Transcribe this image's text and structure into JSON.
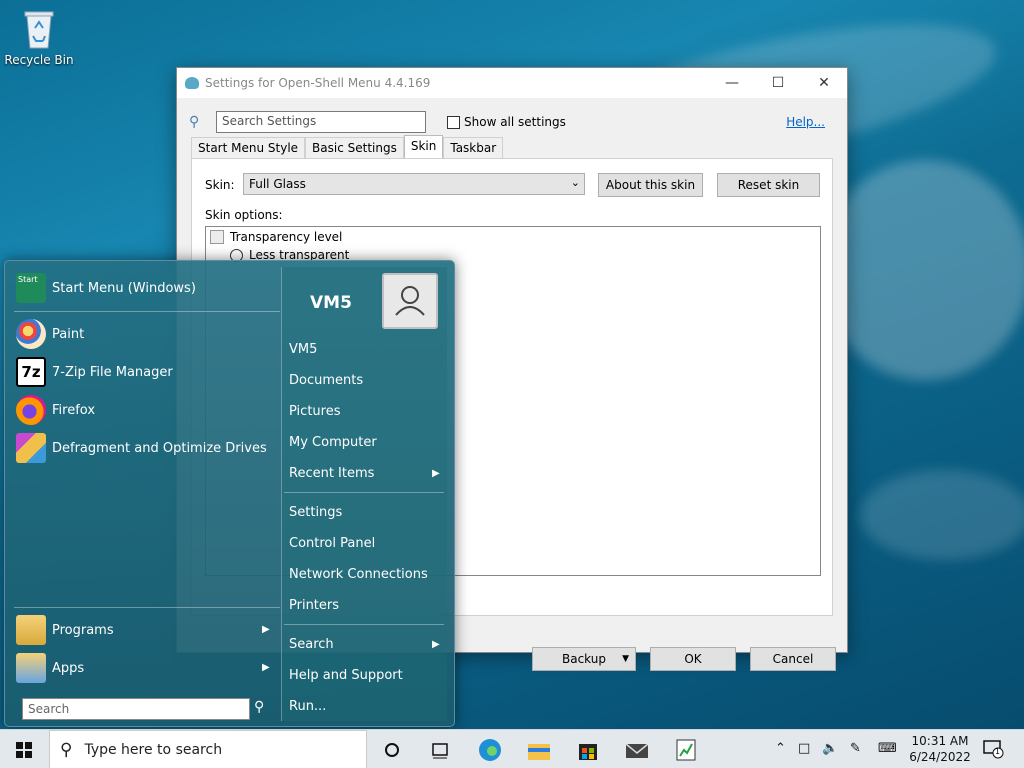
{
  "desktop": {
    "recycle_bin_label": "Recycle Bin"
  },
  "settings_window": {
    "title": "Settings for Open-Shell Menu 4.4.169",
    "search_placeholder": "Search Settings",
    "show_all_label": "Show all settings",
    "help_link": "Help...",
    "tabs": [
      "Start Menu Style",
      "Basic Settings",
      "Skin",
      "Taskbar"
    ],
    "active_tab": "Skin",
    "skin_label": "Skin:",
    "skin_value": "Full Glass",
    "about_skin_button": "About this skin",
    "reset_skin_button": "Reset skin",
    "skin_options_label": "Skin options:",
    "options": {
      "group": "Transparency level",
      "radio1": "Less transparent"
    },
    "backup_button": "Backup",
    "ok_button": "OK",
    "cancel_button": "Cancel"
  },
  "start_menu": {
    "header_item": "Start Menu (Windows)",
    "pinned": [
      "Paint",
      "7-Zip File Manager",
      "Firefox",
      "Defragment and Optimize Drives"
    ],
    "programs": "Programs",
    "apps": "Apps",
    "search_placeholder": "Search",
    "user_name": "VM5",
    "right_items": [
      "VM5",
      "Documents",
      "Pictures",
      "My Computer",
      "Recent Items",
      "Settings",
      "Control Panel",
      "Network Connections",
      "Printers",
      "Search",
      "Help and Support",
      "Run..."
    ]
  },
  "taskbar": {
    "search_placeholder": "Type here to search",
    "time": "10:31 AM",
    "date": "6/24/2022",
    "notification_count": "1"
  }
}
